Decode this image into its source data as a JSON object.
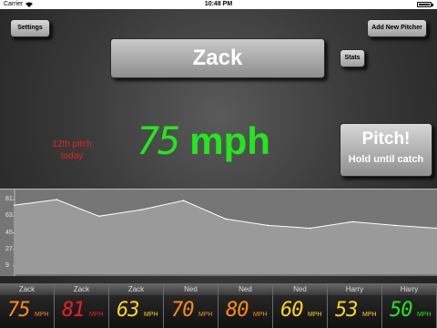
{
  "status_bar": {
    "carrier": "Carrier",
    "time": "10:48 PM"
  },
  "buttons": {
    "settings": "Settings",
    "add_pitcher": "Add New Pitcher",
    "stats": "Stats",
    "pitch_title": "Pitch!",
    "pitch_subtitle": "Hold until catch"
  },
  "pitcher": {
    "name": "Zack"
  },
  "pitch_count": {
    "line1": "12th pitch",
    "line2": "today"
  },
  "speed": {
    "value": "75",
    "unit": "mph"
  },
  "chart_data": {
    "type": "line",
    "ylim": [
      0,
      90
    ],
    "y_ticks": [
      "81",
      "63",
      "45",
      "27",
      "9"
    ],
    "y_tick_values": [
      81,
      63,
      45,
      27,
      9
    ],
    "values": [
      75,
      81,
      63,
      70,
      80,
      60,
      53,
      50,
      57,
      53,
      50
    ]
  },
  "history": [
    {
      "name": "Zack",
      "value": "75",
      "unit": "MPH",
      "color": "#ff8a1a"
    },
    {
      "name": "Zack",
      "value": "81",
      "unit": "MPH",
      "color": "#e8221b"
    },
    {
      "name": "Zack",
      "value": "63",
      "unit": "MPH",
      "color": "#ffd21a"
    },
    {
      "name": "Ned",
      "value": "70",
      "unit": "MPH",
      "color": "#ff8a1a"
    },
    {
      "name": "Ned",
      "value": "80",
      "unit": "MPH",
      "color": "#ff8a1a"
    },
    {
      "name": "Ned",
      "value": "60",
      "unit": "MPH",
      "color": "#ffd21a"
    },
    {
      "name": "Harry",
      "value": "53",
      "unit": "MPH",
      "color": "#ffd21a"
    },
    {
      "name": "Harry",
      "value": "50",
      "unit": "MPH",
      "color": "#22e81c"
    }
  ]
}
